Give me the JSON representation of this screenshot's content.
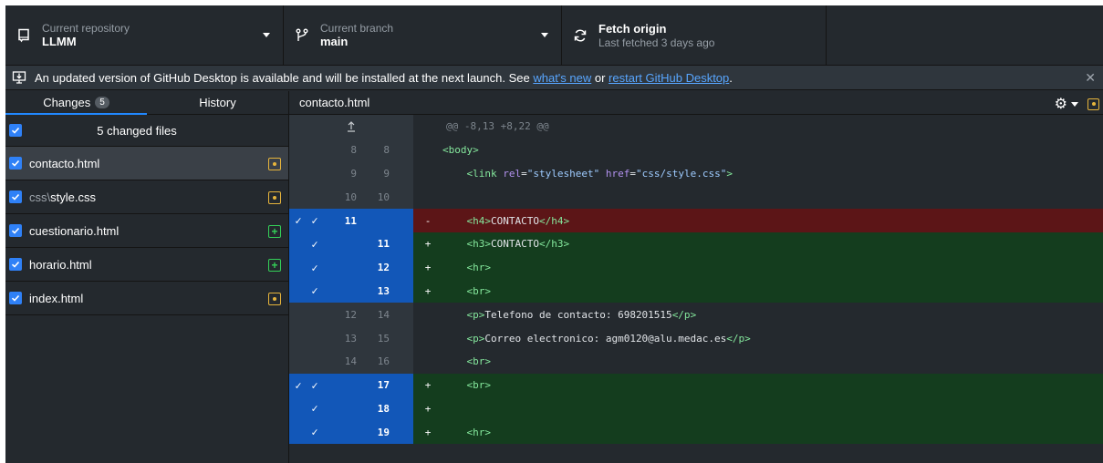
{
  "toolbar": {
    "repo": {
      "desc": "Current repository",
      "title": "LLMM"
    },
    "branch": {
      "desc": "Current branch",
      "title": "main"
    },
    "fetch": {
      "title": "Fetch origin",
      "desc": "Last fetched 3 days ago"
    }
  },
  "banner": {
    "text": "An updated version of GitHub Desktop is available and will be installed at the next launch. See ",
    "link1": "what's new",
    "mid": " or ",
    "link2": "restart GitHub Desktop",
    "end": ".",
    "close": "✕"
  },
  "sidebar": {
    "tabs": {
      "changes": "Changes",
      "count": "5",
      "history": "History"
    },
    "header": "5 changed files",
    "files": [
      {
        "dir": "",
        "name": "contacto.html",
        "status": "modified"
      },
      {
        "dir": "css\\",
        "name": "style.css",
        "status": "modified"
      },
      {
        "dir": "",
        "name": "cuestionario.html",
        "status": "added"
      },
      {
        "dir": "",
        "name": "horario.html",
        "status": "added"
      },
      {
        "dir": "",
        "name": "index.html",
        "status": "modified"
      }
    ]
  },
  "diff": {
    "filename": "contacto.html",
    "hunk": "@@ -8,13 +8,22 @@",
    "lines": [
      {
        "type": "ctx",
        "old": "8",
        "new": "8",
        "marker": "",
        "code": "<body>"
      },
      {
        "type": "ctx",
        "old": "9",
        "new": "9",
        "marker": "",
        "code": "    <link rel=\"stylesheet\" href=\"css/style.css\">"
      },
      {
        "type": "ctx",
        "old": "10",
        "new": "10",
        "marker": "",
        "code": ""
      },
      {
        "type": "del",
        "old": "11",
        "new": "",
        "marker": "-",
        "code": "    <h4>CONTACTO</h4>"
      },
      {
        "type": "add",
        "old": "",
        "new": "11",
        "marker": "+",
        "code": "    <h3>CONTACTO</h3>"
      },
      {
        "type": "add",
        "old": "",
        "new": "12",
        "marker": "+",
        "code": "    <hr>"
      },
      {
        "type": "add",
        "old": "",
        "new": "13",
        "marker": "+",
        "code": "    <br>"
      },
      {
        "type": "ctx",
        "old": "12",
        "new": "14",
        "marker": "",
        "code": "    <p>Telefono de contacto: 698201515</p>"
      },
      {
        "type": "ctx",
        "old": "13",
        "new": "15",
        "marker": "",
        "code": "    <p>Correo electronico: agm0120@alu.medac.es</p>"
      },
      {
        "type": "ctx",
        "old": "14",
        "new": "16",
        "marker": "",
        "code": "    <br>"
      },
      {
        "type": "add",
        "old": "",
        "new": "17",
        "marker": "+",
        "code": "    <br>"
      },
      {
        "type": "add",
        "old": "",
        "new": "18",
        "marker": "+",
        "code": ""
      },
      {
        "type": "add",
        "old": "",
        "new": "19",
        "marker": "+",
        "code": "    <hr>"
      }
    ]
  },
  "colors": {
    "accent": "#2188ff",
    "added": "#34d058",
    "modified": "#e6b43c",
    "deleted_bg": "#5c1517",
    "added_bg": "#143d1e"
  }
}
